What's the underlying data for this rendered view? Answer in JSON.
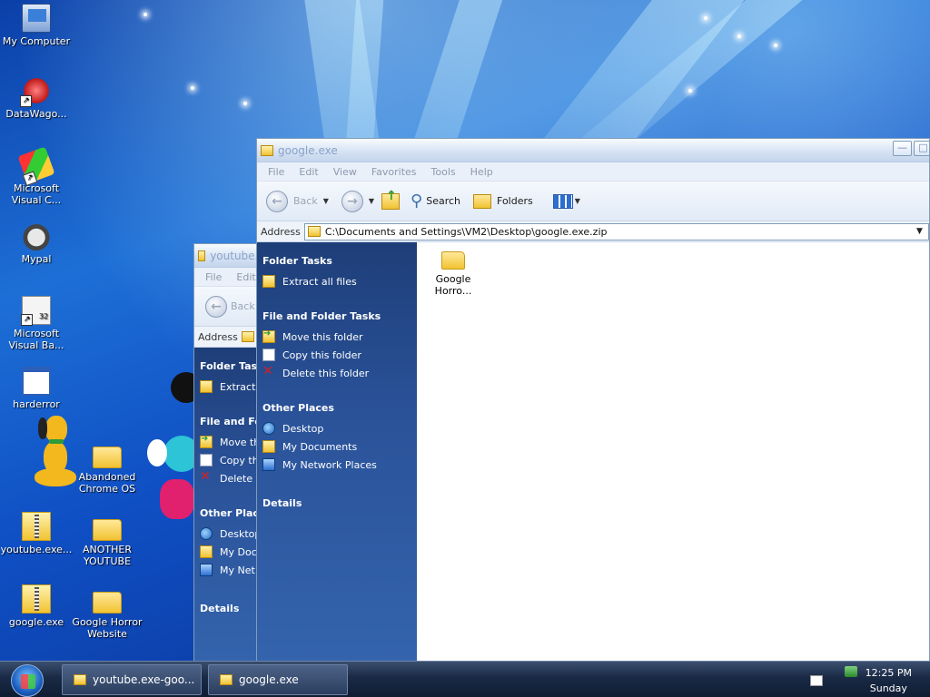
{
  "desktop_icons": [
    {
      "label": "My Computer",
      "icon": "computer-icon"
    },
    {
      "label": "DataWago...",
      "icon": "datawago-icon"
    },
    {
      "label": "Microsoft Visual C...",
      "icon": "visual-c-icon"
    },
    {
      "label": "Mypal",
      "icon": "mypal-icon"
    },
    {
      "label": "Microsoft Visual Ba...",
      "icon": "visual-basic-icon"
    },
    {
      "label": "harderror",
      "icon": "window-icon"
    },
    {
      "label": "Abandoned Chrome OS",
      "icon": "folder-icon"
    },
    {
      "label": "youtube.exe...",
      "icon": "zip-folder-icon"
    },
    {
      "label": "ANOTHER YOUTUBE",
      "icon": "folder-icon"
    },
    {
      "label": "google.exe",
      "icon": "zip-folder-icon"
    },
    {
      "label": "Google Horror Website",
      "icon": "folder-icon"
    }
  ],
  "back_window": {
    "title": "youtube...",
    "menu": [
      "File",
      "Edit"
    ],
    "back_label": "Back",
    "address_label": "Address",
    "folder_tasks": {
      "heading": "Folder Task",
      "items": [
        "Extract"
      ]
    },
    "file_tasks": {
      "heading": "File and Fol",
      "items": [
        "Move th",
        "Copy th",
        "Delete t"
      ]
    },
    "other_places": {
      "heading": "Other Place",
      "items": [
        "Desktop",
        "My Doc",
        "My Net"
      ]
    },
    "details_heading": "Details"
  },
  "front_window": {
    "title": "google.exe",
    "menu": [
      "File",
      "Edit",
      "View",
      "Favorites",
      "Tools",
      "Help"
    ],
    "toolbar": {
      "back": "Back",
      "search": "Search",
      "folders": "Folders"
    },
    "address_label": "Address",
    "address_value": "C:\\Documents and Settings\\VM2\\Desktop\\google.exe.zip",
    "folder_tasks": {
      "heading": "Folder Tasks",
      "items": [
        {
          "label": "Extract all files",
          "icon": "extract-icon"
        }
      ]
    },
    "file_tasks": {
      "heading": "File and Folder Tasks",
      "items": [
        {
          "label": "Move this folder",
          "icon": "move-icon"
        },
        {
          "label": "Copy this folder",
          "icon": "copy-icon"
        },
        {
          "label": "Delete this folder",
          "icon": "delete-icon"
        }
      ]
    },
    "other_places": {
      "heading": "Other Places",
      "items": [
        {
          "label": "Desktop",
          "icon": "desktop-icon"
        },
        {
          "label": "My Documents",
          "icon": "my-documents-icon"
        },
        {
          "label": "My Network Places",
          "icon": "network-places-icon"
        }
      ]
    },
    "details_heading": "Details",
    "content_items": [
      {
        "label_line1": "Google",
        "label_line2": "Horro...",
        "icon": "folder-icon"
      }
    ]
  },
  "taskbar": {
    "tasks": [
      "youtube.exe-goo...",
      "google.exe"
    ],
    "time": "12:25 PM",
    "day": "Sunday"
  },
  "colors": {
    "accent": "#1d6fd6",
    "taskpane": "#2a5299",
    "taskbar": "#1a2a45"
  }
}
